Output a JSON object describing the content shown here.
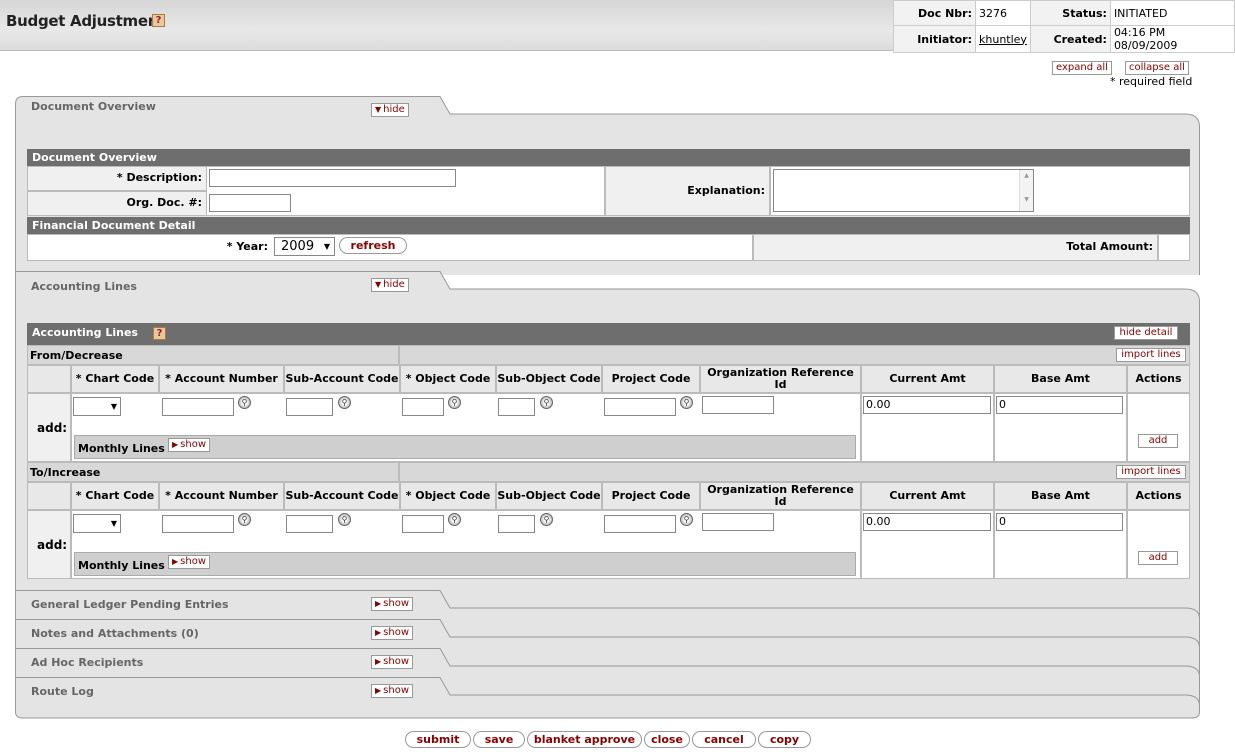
{
  "header": {
    "title": "Budget Adjustment",
    "doc_nbr_label": "Doc Nbr:",
    "doc_nbr": "3276",
    "status_label": "Status:",
    "status": "INITIATED",
    "initiator_label": "Initiator:",
    "initiator": "khuntley",
    "created_label": "Created:",
    "created": "04:16 PM 08/09/2009"
  },
  "controls": {
    "expand_all": "expand all",
    "collapse_all": "collapse all",
    "required_note": "* required field"
  },
  "doc_overview": {
    "tab_label": "Document Overview",
    "hide": "hide",
    "box_title": "Document Overview",
    "description_label": "* Description:",
    "org_doc_label": "Org. Doc. #:",
    "explanation_label": "Explanation:",
    "fin_detail_title": "Financial Document Detail",
    "year_label": "* Year:",
    "year_value": "2009",
    "refresh": "refresh",
    "total_amount_label": "Total Amount:"
  },
  "accounting": {
    "tab_label": "Accounting Lines",
    "hide": "hide",
    "box_title": "Accounting Lines",
    "hide_detail": "hide detail",
    "import_lines": "import lines",
    "from_label": "From/Decrease",
    "to_label": "To/Increase",
    "columns": [
      "* Chart Code",
      "* Account Number",
      "Sub-Account Code",
      "* Object Code",
      "Sub-Object Code",
      "Project Code",
      "Organization Reference Id",
      "Current Amt",
      "Base Amt",
      "Actions"
    ],
    "add_label": "add:",
    "monthly_lines": "Monthly Lines",
    "show": "show",
    "current_amt_value": "0.00",
    "base_amt_value": "0",
    "add_button": "add"
  },
  "collapsed_tabs": [
    {
      "label": "General Ledger Pending Entries",
      "button": "show"
    },
    {
      "label": "Notes and Attachments (0)",
      "button": "show"
    },
    {
      "label": "Ad Hoc Recipients",
      "button": "show"
    },
    {
      "label": "Route Log",
      "button": "show"
    }
  ],
  "bottom_buttons": [
    "submit",
    "save",
    "blanket approve",
    "close",
    "cancel",
    "copy"
  ],
  "icons": [
    "help-icon",
    "lookup-icon",
    "triangle-right-icon",
    "triangle-down-icon"
  ]
}
